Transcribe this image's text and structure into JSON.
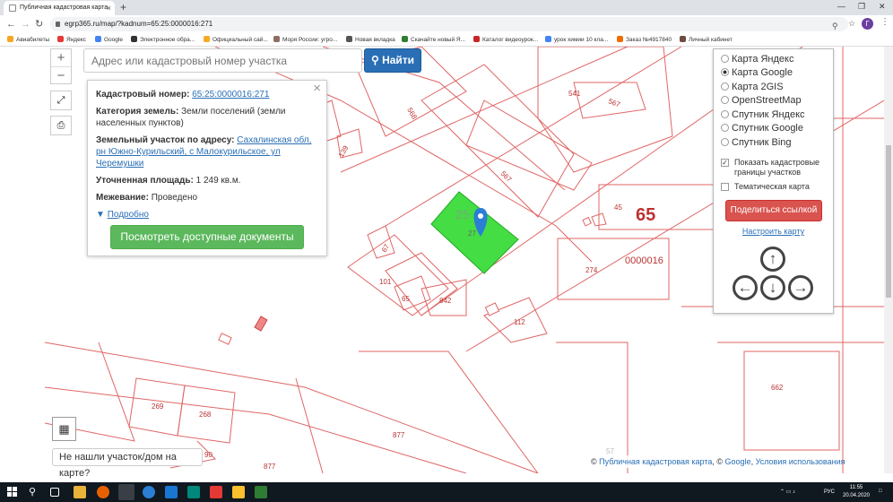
{
  "browser": {
    "tab_title": "Публичная кадастровая карта",
    "tab_close": "×",
    "new_tab": "+",
    "url": "egrp365.ru/map/?kadnum=65:25:0000016:271",
    "avatar_letter": "Г",
    "bookmarks": [
      "Авиабилеты",
      "Яндекс",
      "Google",
      "Электронное обра...",
      "Официальный сай...",
      "Моря России: угро...",
      "Новая вкладка",
      "Скачайте новый Я...",
      "Каталог видеоурок...",
      "урок химии 10 кла...",
      "Заказ №4917840",
      "Личный кабинет"
    ]
  },
  "map": {
    "zoom_in": "+",
    "zoom_out": "−",
    "search_placeholder": "Адрес или кадастровый номер участка",
    "search_button": "Найти",
    "labels": [
      "541",
      "567",
      "568",
      "139",
      "567",
      "25",
      "27",
      "45",
      "65",
      "274",
      "0000016",
      "67",
      "101",
      "65",
      "842",
      "112",
      "269",
      "268",
      "877",
      "877",
      "662",
      "90",
      "57"
    ],
    "colors": {
      "parcel_border": "#e06666",
      "highlight_fill": "#44dd44",
      "marker": "#2a7fd4"
    }
  },
  "popup": {
    "close": "×",
    "kad_label": "Кадастровый номер:",
    "kad_value": "65:25:0000016:271",
    "category_label": "Категория земель:",
    "category_value": "Земли поселений (земли населенных пунктов)",
    "address_label": "Земельный участок по адресу:",
    "address_value": "Сахалинская обл, рн Южно-Курильский, с Малокурильское, ул Черемушки",
    "area_label": "Уточненная площадь:",
    "area_value": "1 249 кв.м.",
    "survey_label": "Межевание:",
    "survey_value": "Проведено",
    "more_link": "Подробно",
    "docs_button": "Посмотреть доступные документы"
  },
  "panel": {
    "map_types": [
      "Карта Яндекс",
      "Карта Google",
      "Карта 2GIS",
      "OpenStreetMap",
      "Спутник Яндекс",
      "Спутник Google",
      "Спутник Bing"
    ],
    "selected_index": 1,
    "show_borders_label": "Показать кадастровые границы участков",
    "thematic_label": "Тематическая карта",
    "share_button": "Поделиться ссылкой",
    "tune_link": "Настроить карту"
  },
  "footer": {
    "not_found": "Не нашли участок/дом на карте?",
    "copyright_prefix": "©",
    "copyright_pkk": "Публичная кадастровая карта",
    "copyright_google": "Google",
    "copyright_terms": "Условия использования"
  },
  "taskbar": {
    "lang": "РУС",
    "time": "11:55",
    "date": "20.04.2020"
  }
}
